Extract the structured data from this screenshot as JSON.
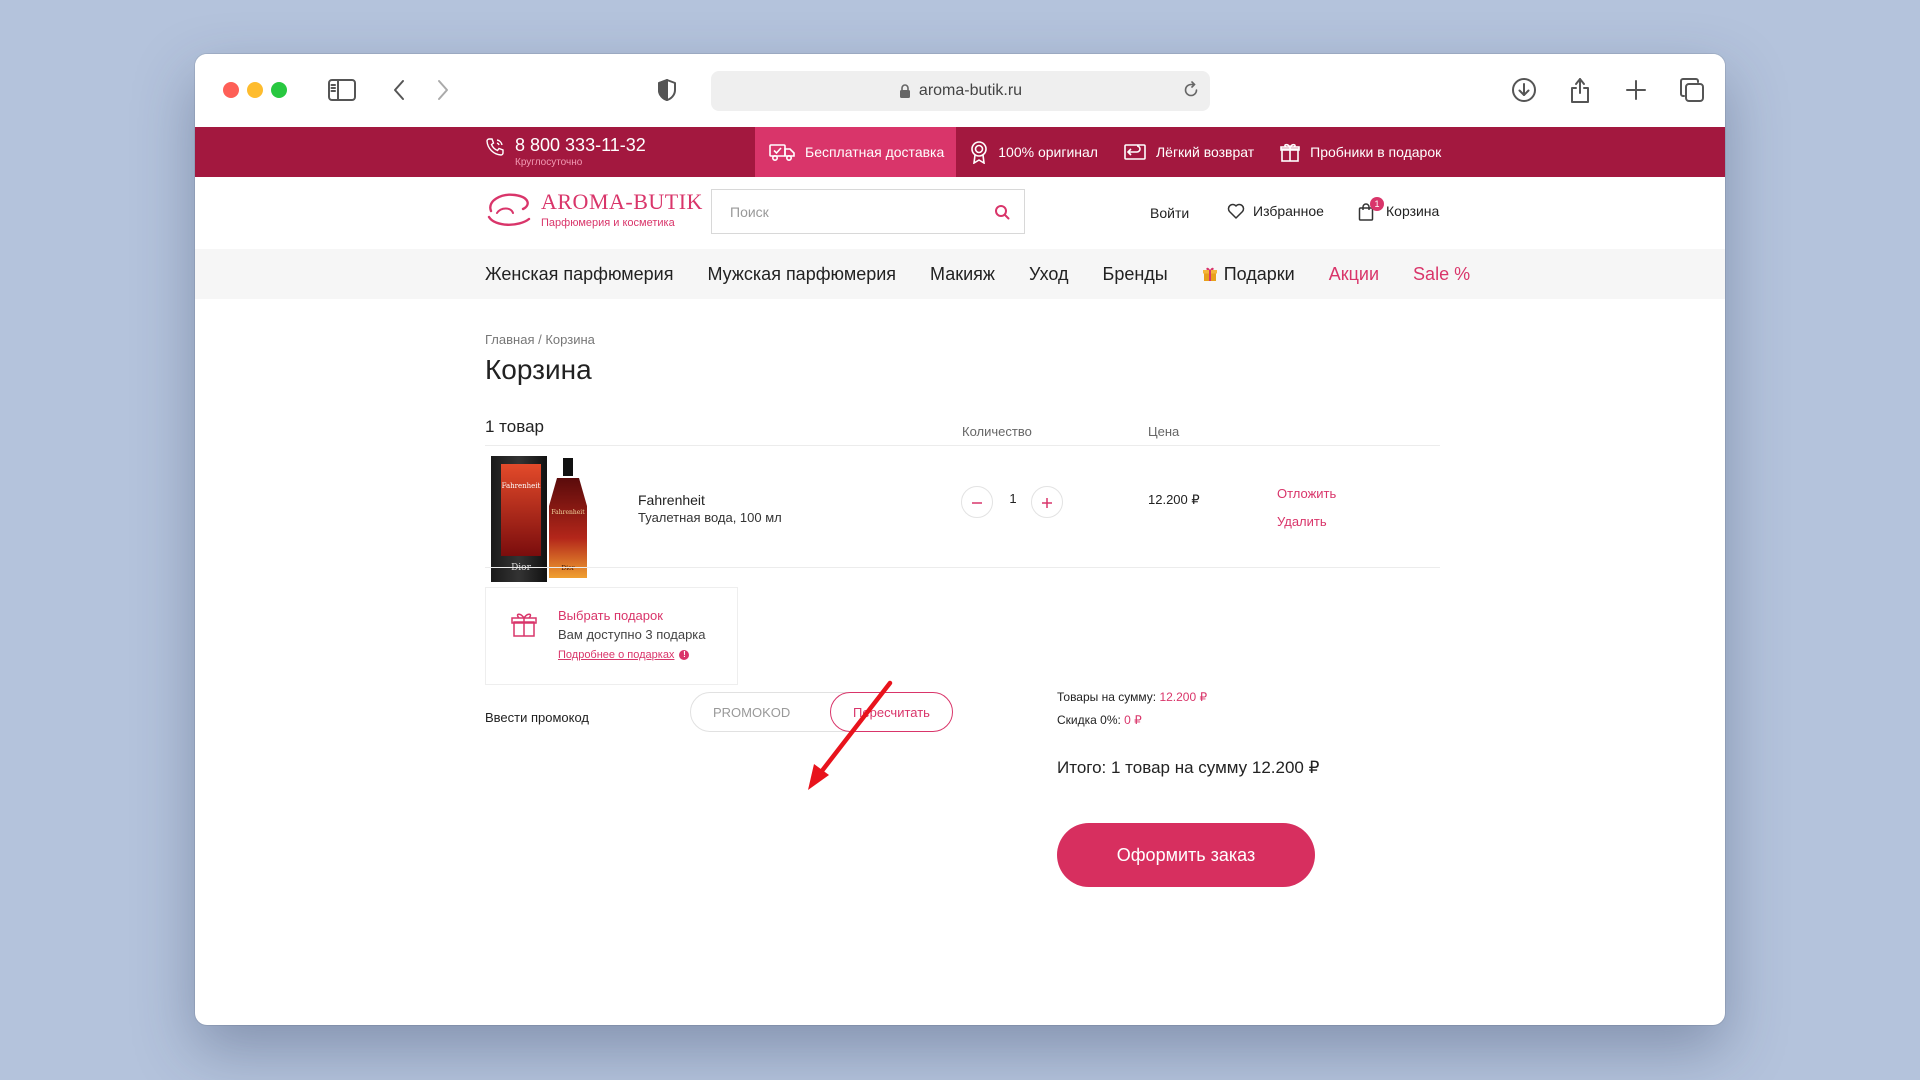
{
  "browser": {
    "url": "aroma-butik.ru"
  },
  "topbar": {
    "phone": "8 800 333-11-32",
    "phone_note": "Круглосуточно",
    "perks": [
      {
        "icon": "truck-icon",
        "label": "Бесплатная доставка"
      },
      {
        "icon": "award-icon",
        "label": "100% оригинал"
      },
      {
        "icon": "return-icon",
        "label": "Лёгкий возврат"
      },
      {
        "icon": "gift-icon",
        "label": "Пробники в подарок"
      }
    ]
  },
  "header": {
    "logo_brand": "AROMA-BUTIK",
    "logo_tagline": "Парфюмерия и косметика",
    "search_placeholder": "Поиск",
    "login": "Войти",
    "favorites": "Избранное",
    "cart": "Корзина",
    "cart_count": "1"
  },
  "nav": {
    "items": [
      "Женская парфюмерия",
      "Мужская парфюмерия",
      "Макияж",
      "Уход",
      "Бренды",
      "Подарки",
      "Акции",
      "Sale %"
    ]
  },
  "breadcrumb": {
    "home": "Главная",
    "separator": "/",
    "current": "Корзина"
  },
  "page_title": "Корзина",
  "cart_table": {
    "items_count": "1 товар",
    "col_quantity": "Количество",
    "col_price": "Цена",
    "items": [
      {
        "name": "Fahrenheit",
        "description": "Туалетная вода, 100 мл",
        "quantity": "1",
        "price": "12.200 ₽",
        "postpone": "Отложить",
        "remove": "Удалить"
      }
    ]
  },
  "gift": {
    "title": "Выбрать подарок",
    "subtitle": "Вам доступно 3 подарка",
    "more": "Подробнее о подарках"
  },
  "promo": {
    "label": "Ввести промокод",
    "placeholder": "PROMOKOD",
    "button": "Пересчитать"
  },
  "summary": {
    "goods_label": "Товары на сумму:",
    "goods_value": "12.200 ₽",
    "discount_label": "Скидка 0%:",
    "discount_value": "0 ₽",
    "total": "Итого: 1 товар на сумму 12.200 ₽",
    "checkout": "Оформить заказ"
  },
  "colors": {
    "brand_dark": "#a3183f",
    "brand_accent": "#d9356a",
    "background": "#b4c3dc"
  }
}
